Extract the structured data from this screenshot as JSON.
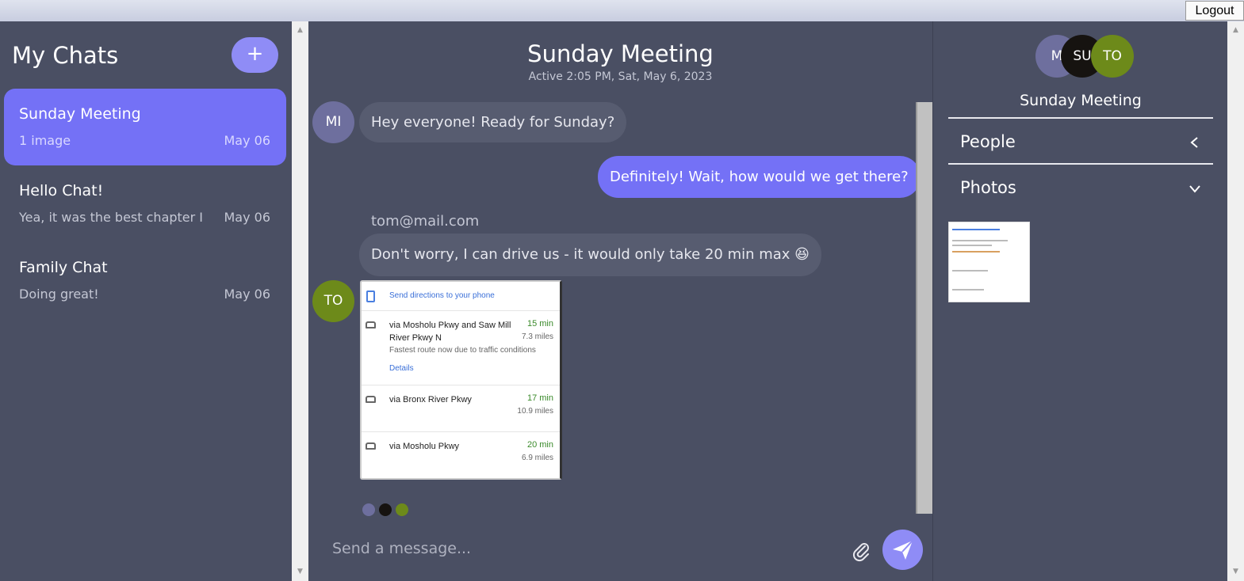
{
  "topbar": {
    "logout_label": "Logout"
  },
  "sidebar": {
    "title": "My Chats",
    "new_chat_label": "+",
    "chats": [
      {
        "name": "Sunday Meeting",
        "preview": "1 image",
        "date": "May 06",
        "active": true
      },
      {
        "name": "Hello Chat!",
        "preview": "Yea, it was the best chapter I",
        "date": "May 06",
        "active": false
      },
      {
        "name": "Family Chat",
        "preview": "Doing great!",
        "date": "May 06",
        "active": false
      }
    ]
  },
  "chat": {
    "title": "Sunday Meeting",
    "subtitle": "Active 2:05 PM, Sat, May 6, 2023",
    "messages": [
      {
        "avatar": "MI",
        "text": "Hey everyone! Ready for Sunday?"
      },
      {
        "text": "Definitely! Wait, how would we get there?"
      },
      {
        "sender": "tom@mail.com",
        "avatar": "TO",
        "text": "Don't worry, I can drive us - it would only take 20 min max 😆"
      }
    ],
    "map_image": {
      "header": "Send directions to your phone",
      "routes": [
        {
          "via": "via Mosholu Pkwy and Saw Mill River Pkwy N",
          "duration": "15 min",
          "distance": "7.3 miles",
          "note": "Fastest route now due to traffic conditions",
          "details": "Details"
        },
        {
          "via": "via Bronx River Pkwy",
          "duration": "17 min",
          "distance": "10.9 miles"
        },
        {
          "via": "via Mosholu Pkwy",
          "duration": "20 min",
          "distance": "6.9 miles"
        }
      ]
    },
    "composer": {
      "placeholder": "Send a message..."
    }
  },
  "details": {
    "avatars": [
      "M",
      "SU",
      "TO"
    ],
    "name": "Sunday Meeting",
    "sections": [
      {
        "label": "People"
      },
      {
        "label": "Photos"
      }
    ]
  },
  "colors": {
    "background": "#4a4f63",
    "accent": "#7471f6",
    "button": "#8f8cf6",
    "avatar_mi": "#6e6f9e",
    "avatar_su": "#161310",
    "avatar_to": "#6d8a1a"
  }
}
